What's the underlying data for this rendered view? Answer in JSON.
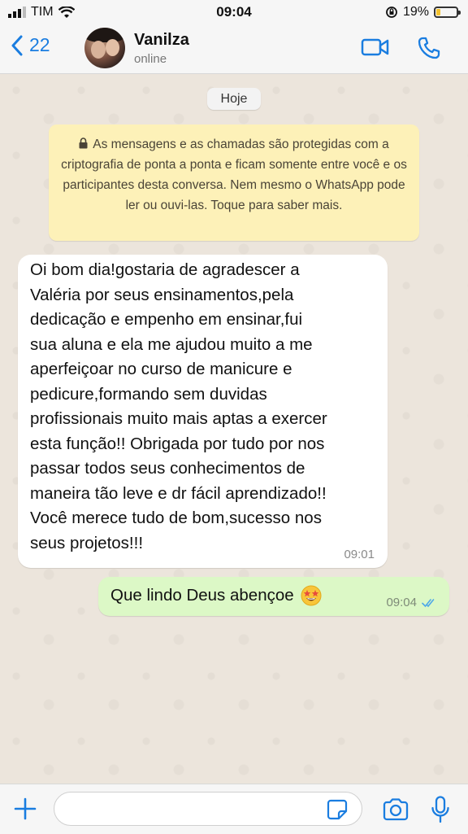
{
  "status_bar": {
    "carrier": "TIM",
    "time": "09:04",
    "battery_percent": "19%",
    "battery_level": 0.19,
    "icons": [
      "signal-icon",
      "wifi-icon",
      "orientation-lock-icon",
      "battery-icon"
    ]
  },
  "header": {
    "back_count": "22",
    "contact_name": "Vanilza",
    "presence": "online",
    "icons": [
      "chevron-left-icon",
      "video-call-icon",
      "phone-call-icon"
    ],
    "accent_color": "#1a7de0"
  },
  "chat": {
    "date_chip": "Hoje",
    "encryption_notice": "As mensagens e as chamadas são protegidas com a criptografia de ponta a ponta e ficam somente entre você e os participantes desta conversa. Nem mesmo o WhatsApp pode ler ou ouvi-las. Toque para saber mais.",
    "messages": [
      {
        "direction": "incoming",
        "text": "Oi bom dia!gostaria de agradescer a\nValéria por seus ensinamentos,pela\ndedicação e empenho em ensinar,fui\nsua aluna e ela me ajudou muito a me\naperfeiçoar no curso de manicure e\npedicure,formando sem duvidas\nprofissionais muito mais aptas a exercer\nesta função!! Obrigada por tudo por nos\npassar todos seus conhecimentos de\nmaneira tão leve e dr fácil aprendizado!!\nVocê merece tudo de bom,sucesso nos\nseus projetos!!!",
        "time": "09:01"
      },
      {
        "direction": "outgoing",
        "text": "Que lindo Deus abençoe",
        "emoji": "star-struck-emoji",
        "time": "09:04",
        "status": "read-double-check-icon"
      }
    ]
  },
  "composer": {
    "placeholder": "",
    "icons": [
      "plus-icon",
      "sticker-icon",
      "camera-icon",
      "microphone-icon"
    ]
  }
}
